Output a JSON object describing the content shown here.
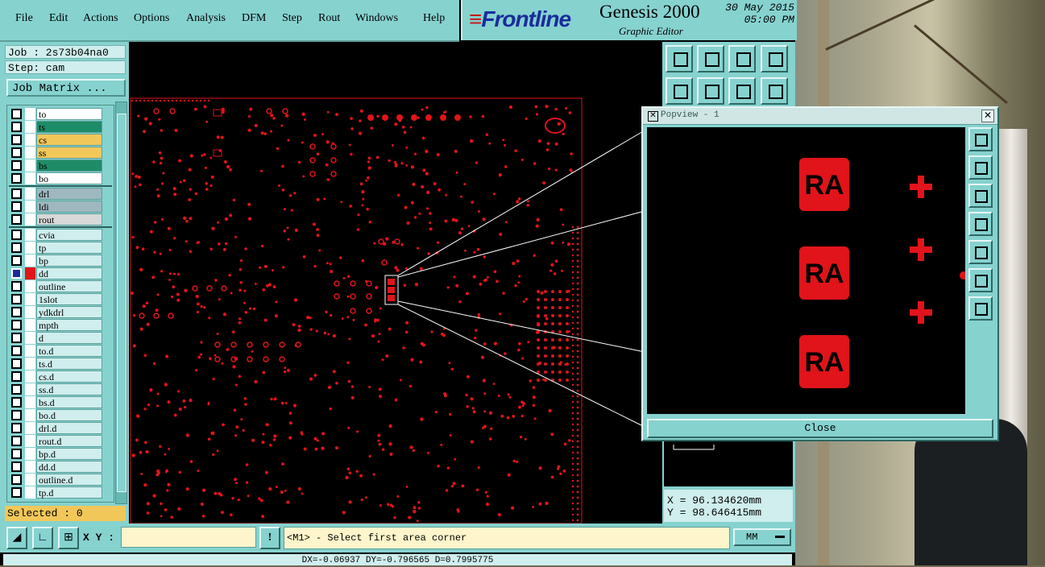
{
  "menu": {
    "items": [
      "File",
      "Edit",
      "Actions",
      "Options",
      "Analysis",
      "DFM",
      "Step",
      "Rout",
      "Windows",
      "Help"
    ]
  },
  "brand": {
    "logo": "Frontline",
    "product": "Genesis 2000",
    "subtitle": "Graphic Editor",
    "date": "30 May 2015",
    "time": "05:00 PM"
  },
  "job": {
    "job_line": "Job : 2s73b04na0",
    "step_line": "Step: cam",
    "job_matrix_label": "Job Matrix ...",
    "selected_text": "Selected : 0"
  },
  "layers": [
    {
      "name": "to",
      "color": "#ffffff",
      "marker": "✎"
    },
    {
      "name": "ts",
      "color": "#1e8c66",
      "marker": ""
    },
    {
      "name": "cs",
      "color": "#f2c75a",
      "marker": ""
    },
    {
      "name": "ss",
      "color": "#f2c75a",
      "marker": ""
    },
    {
      "name": "bs",
      "color": "#1e8c66",
      "marker": ""
    },
    {
      "name": "bo",
      "color": "#ffffff",
      "marker": "✎"
    },
    {
      "name": "drl",
      "color": "#9fb8c0",
      "marker": ""
    },
    {
      "name": "ldi",
      "color": "#9fb8c0",
      "marker": ""
    },
    {
      "name": "rout",
      "color": "#d8d8d8",
      "marker": ""
    },
    {
      "name": "cvia",
      "color": "#cfeeed",
      "marker": ""
    },
    {
      "name": "tp",
      "color": "#cfeeed",
      "marker": ""
    },
    {
      "name": "bp",
      "color": "#cfeeed",
      "marker": ""
    },
    {
      "name": "dd",
      "color": "#cfeeed",
      "marker": "⊞"
    },
    {
      "name": "outline",
      "color": "#cfeeed",
      "marker": ""
    },
    {
      "name": "1slot",
      "color": "#cfeeed",
      "marker": ""
    },
    {
      "name": "ydkdrl",
      "color": "#cfeeed",
      "marker": ""
    },
    {
      "name": "mpth",
      "color": "#cfeeed",
      "marker": ""
    },
    {
      "name": "d",
      "color": "#cfeeed",
      "marker": ""
    },
    {
      "name": "to.d",
      "color": "#cfeeed",
      "marker": "✎"
    },
    {
      "name": "ts.d",
      "color": "#cfeeed",
      "marker": ""
    },
    {
      "name": "cs.d",
      "color": "#cfeeed",
      "marker": ""
    },
    {
      "name": "ss.d",
      "color": "#cfeeed",
      "marker": ""
    },
    {
      "name": "bs.d",
      "color": "#cfeeed",
      "marker": ""
    },
    {
      "name": "bo.d",
      "color": "#cfeeed",
      "marker": "✎"
    },
    {
      "name": "drl.d",
      "color": "#cfeeed",
      "marker": ""
    },
    {
      "name": "rout.d",
      "color": "#cfeeed",
      "marker": ""
    },
    {
      "name": "bp.d",
      "color": "#cfeeed",
      "marker": ""
    },
    {
      "name": "dd.d",
      "color": "#cfeeed",
      "marker": ""
    },
    {
      "name": "outline.d",
      "color": "#cfeeed",
      "marker": ""
    },
    {
      "name": "tp.d",
      "color": "#cfeeed",
      "marker": ""
    }
  ],
  "coords": {
    "x": "X = 96.134620mm",
    "y": "Y = 98.646415mm"
  },
  "bottom": {
    "xy_label": "X Y :",
    "xy_value": "",
    "alert_glyph": "!",
    "message": "<M1> - Select first area corner",
    "units": "MM",
    "status": "DX=-0.06937 DY=-0.796565 D=0.7995775"
  },
  "popview": {
    "title": "Popview - 1",
    "close_label": "Close",
    "pad_text": "RA"
  },
  "colors": {
    "feature_red": "#e0141a",
    "panel_teal": "#86d2cf",
    "canvas_black": "#000000"
  }
}
